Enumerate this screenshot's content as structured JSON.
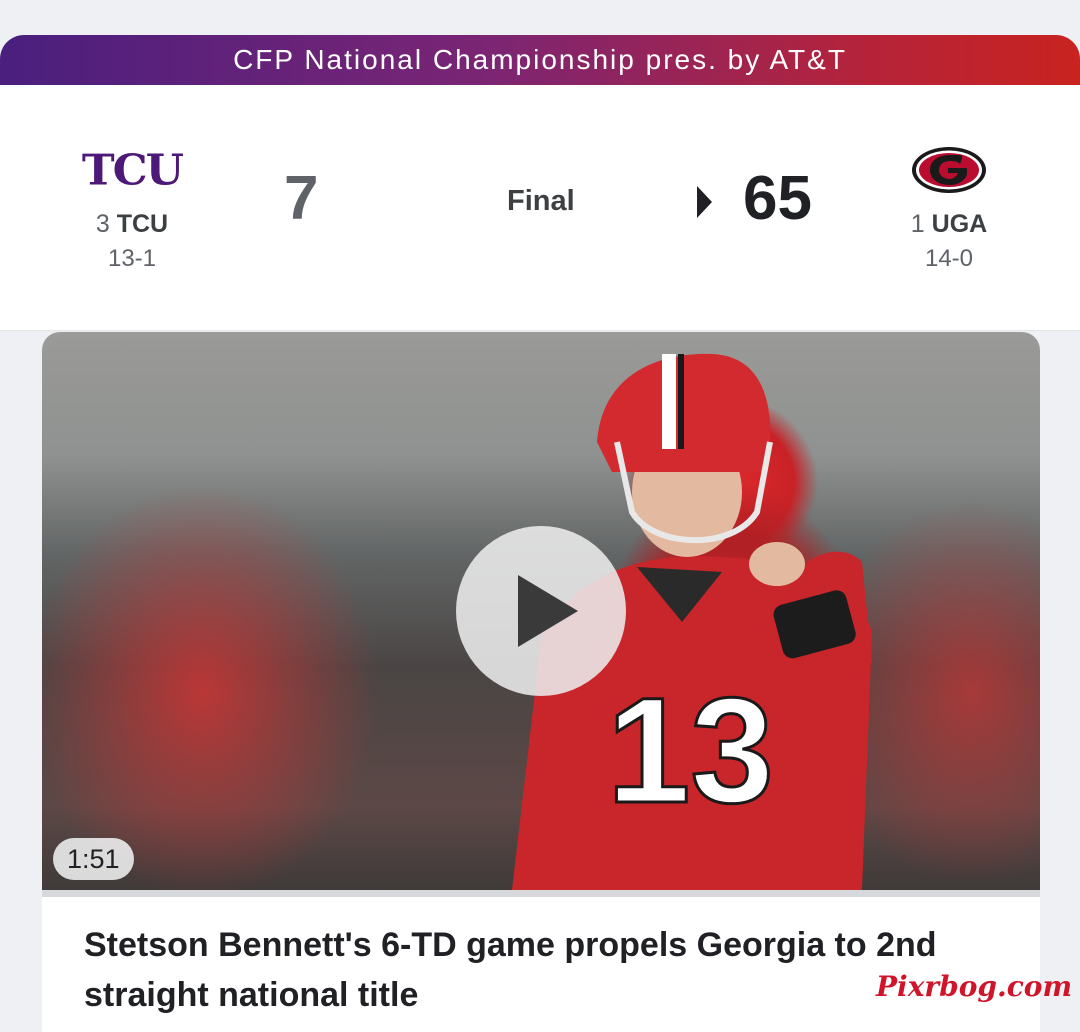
{
  "banner": {
    "title": "CFP National Championship pres. by AT&T"
  },
  "game": {
    "status": "Final",
    "away": {
      "logo_text": "TCU",
      "rank": "3",
      "abbr": "TCU",
      "record": "13-1",
      "score": "7"
    },
    "home": {
      "logo_icon": "georgia-g-logo",
      "rank": "1",
      "abbr": "UGA",
      "record": "14-0",
      "score": "65",
      "winner": true
    }
  },
  "video": {
    "duration": "1:51",
    "headline": "Stetson Bennett's 6-TD game propels Georgia to 2nd straight national title",
    "thumbnail": "Georgia quarterback #13 in red jersey pointing at camera"
  },
  "watermark": "Pixrbog.com",
  "colors": {
    "tcu_purple": "#4d1979",
    "uga_red": "#ba0c2f",
    "banner_start": "#4a1f7e",
    "banner_end": "#c8231f"
  }
}
